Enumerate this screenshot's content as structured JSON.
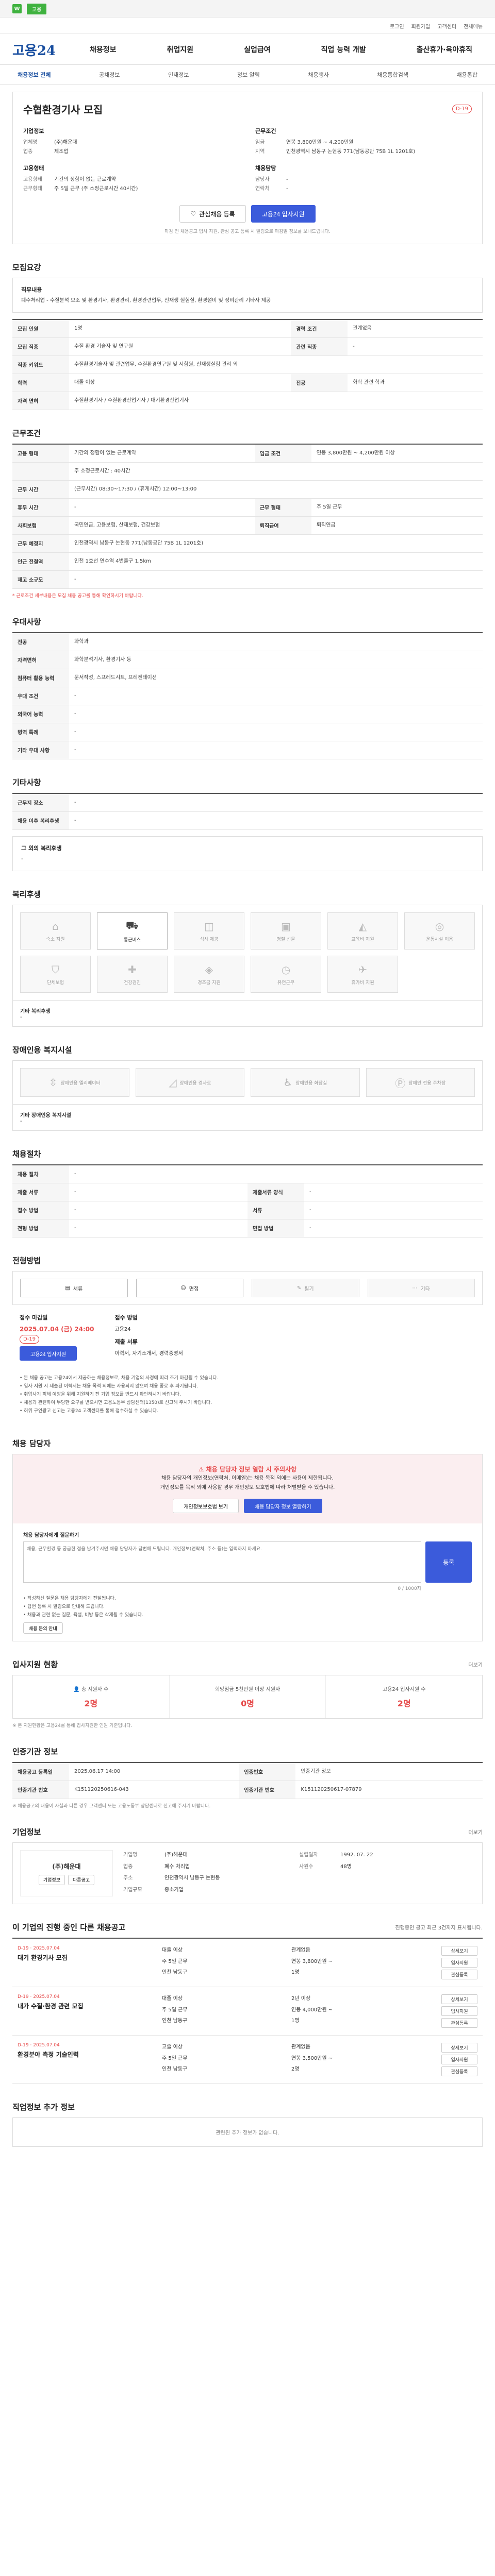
{
  "topbar": {
    "badge": "W",
    "pill": "고용",
    "links": [
      "로그인",
      "회원가입",
      "고객센터",
      "전체메뉴"
    ]
  },
  "header": {
    "logo": "고용24",
    "gnb": [
      "채용정보",
      "취업지원",
      "실업급여",
      "직업 능력 개발",
      "출산휴가·육아휴직"
    ]
  },
  "lnb": [
    "채용정보 전체",
    "공채정보",
    "인재정보",
    "정보 알림",
    "채용행사",
    "채용통합검색",
    "채용통합"
  ],
  "summary": {
    "title": "수협환경기사 모집",
    "dday": "D-19",
    "company_h": "기업정보",
    "company_rows": [
      {
        "k": "업체명",
        "v": "(주)해운대"
      },
      {
        "k": "업종",
        "v": "제조업"
      }
    ],
    "cond_h": "근무조건",
    "cond_rows": [
      {
        "k": "임금",
        "v": "연봉 3,800만원 ~ 4,200만원"
      },
      {
        "k": "지역",
        "v": "인천광역시 남동구 논현동 771(남동공단 75B 1L 1201호)"
      }
    ],
    "qual_h": "고용형태",
    "qual_rows": [
      {
        "k": "고용형태",
        "v": "기간의 정함이 없는 근로계약"
      },
      {
        "k": "근무형태",
        "v": "주 5일 근무 (주 소정근로시간 40시간)"
      }
    ],
    "etc_h": "채용담당",
    "etc_rows": [
      {
        "k": "담당자",
        "v": "-"
      },
      {
        "k": "연락처",
        "v": "-"
      }
    ],
    "btn_scrap": "관심채용 등록",
    "btn_apply": "고용24 입사지원",
    "note": "마감 전 채용공고 입사 지원, 관심 공고 등록 시 알림으로 마감일 정보를 보내드립니다."
  },
  "recruit": {
    "title": "모집요강",
    "duty_label": "직무내용",
    "duty_text": "폐수처리업 - 수질분석 보조 및 환경기사, 환경관리, 환경관련업무, 신재생 실험실, 환경설비 및 정비관리 기타사 제공",
    "rows": [
      {
        "k": "모집 인원",
        "v": "1명",
        "k2": "경력 조건",
        "v2": "관계없음"
      },
      {
        "k": "모집 직종",
        "v": "수질 환경 기술자 및 연구원",
        "k2": "관련 직종",
        "v2": "-"
      },
      {
        "k": "직종 키워드",
        "v": "수질환경기술자 및 관련업무, 수질환경연구원 및 시험원, 신재생실험 관리 외",
        "k2": "",
        "v2": ""
      },
      {
        "k": "학력",
        "v": "대졸 이상",
        "k2": "전공",
        "v2": "화학 관련 학과"
      },
      {
        "k": "자격 면허",
        "v": "수질환경기사 / 수질환경산업기사 / 대기환경산업기사",
        "k2": "",
        "v2": ""
      }
    ]
  },
  "work": {
    "title": "근무조건",
    "rows": [
      {
        "k": "고용 형태",
        "v": "기간의 정함이 없는 근로계약",
        "k2": "임금 조건",
        "v2": "연봉 3,800만원 ~ 4,200만원 이상"
      },
      {
        "k": "",
        "v": "주 소정근로시간 : 40시간",
        "k2": "",
        "v2": ""
      },
      {
        "k": "근무 시간",
        "v": "(근무시간) 08:30~17:30 / (휴게시간) 12:00~13:00",
        "k2": "",
        "v2": ""
      },
      {
        "k": "휴무 시간",
        "v": "-",
        "k2": "근무 형태",
        "v2": "주 5일 근무"
      },
      {
        "k": "사회보험",
        "v": "국민연금, 고용보험, 산재보험, 건강보험",
        "k2": "퇴직급여",
        "v2": "퇴직연금"
      },
      {
        "k": "근무 예정지",
        "v": "인천광역시 남동구 논현동 771(남동공단 75B 1L 1201호)",
        "k2": "",
        "v2": ""
      },
      {
        "k": "인근 전철역",
        "v": "인천 1호선 연수역 4번출구 1.5km",
        "k2": "",
        "v2": ""
      },
      {
        "k": "재고 소규모",
        "v": "-",
        "k2": "",
        "v2": ""
      }
    ],
    "note": "* 근로조건 세부내용은 모집 채용 공고를 통해 확인하시기 바랍니다."
  },
  "prefer": {
    "title": "우대사항",
    "rows": [
      {
        "k": "전공",
        "v": "화학과"
      },
      {
        "k": "자격면허",
        "v": "화학분석기사, 환경기사 등"
      },
      {
        "k": "컴퓨터 활용 능력",
        "v": "문서작성, 스프레드시트, 프레젠테이션"
      },
      {
        "k": "우대 조건",
        "v": "-"
      },
      {
        "k": "외국어 능력",
        "v": "-"
      },
      {
        "k": "병역 특례",
        "v": "-"
      },
      {
        "k": "기타 우대 사항",
        "v": "-"
      }
    ]
  },
  "other": {
    "title": "기타사항",
    "rows": [
      {
        "k": "근무지 장소",
        "v": "-"
      },
      {
        "k": "채용 이후 복리후생",
        "v": "-"
      }
    ],
    "extra_label": "그 외의 복리후생",
    "extra_val": "-"
  },
  "welfare": {
    "title": "복리후생",
    "items": [
      {
        "icon": "house-icon",
        "label": "숙소 지원",
        "on": false
      },
      {
        "icon": "car-icon",
        "label": "통근버스",
        "on": true
      },
      {
        "icon": "meal-icon",
        "label": "식사 제공",
        "on": false
      },
      {
        "icon": "gift-icon",
        "label": "명절 선물",
        "on": false
      },
      {
        "icon": "education-icon",
        "label": "교육비 지원",
        "on": false
      },
      {
        "icon": "sports-icon",
        "label": "운동시설 이용",
        "on": false
      },
      {
        "icon": "shield-icon",
        "label": "단체보험",
        "on": false
      },
      {
        "icon": "medical-icon",
        "label": "건강검진",
        "on": false
      },
      {
        "icon": "money-icon",
        "label": "경조금 지원",
        "on": false
      },
      {
        "icon": "clock-icon",
        "label": "유연근무",
        "on": false
      },
      {
        "icon": "plane-icon",
        "label": "휴가비 지원",
        "on": false
      }
    ],
    "extra_label": "기타 복리후생",
    "extra_val": "-"
  },
  "disabled": {
    "title": "장애인용 복지시설",
    "items": [
      {
        "icon": "elevator-icon",
        "label": "장애인용 엘리베이터",
        "on": false
      },
      {
        "icon": "ramp-icon",
        "label": "장애인용 경사로",
        "on": false
      },
      {
        "icon": "toilet-icon",
        "label": "장애인용 화장실",
        "on": false
      },
      {
        "icon": "parking-icon",
        "label": "장애인 전용 주차장",
        "on": false
      }
    ],
    "extra_label": "기타 장애인용 복지시설",
    "extra_val": "-"
  },
  "attach": {
    "title": "채용절차",
    "rows": [
      {
        "k": "채용 절차",
        "v": "-",
        "k2": "",
        "v2": ""
      },
      {
        "k": "제출 서류",
        "v": "-",
        "k2": "제출서류 양식",
        "v2": "-"
      },
      {
        "k": "접수 방법",
        "v": "-",
        "k2": "서류",
        "v2": "-"
      },
      {
        "k": "전형 방법",
        "v": "-",
        "k2": "면접 방법",
        "v2": "-"
      }
    ]
  },
  "procedure": {
    "title": "전형방법",
    "steps": [
      {
        "icon": "document-icon",
        "label": "서류",
        "on": true
      },
      {
        "icon": "interview-icon",
        "label": "면접",
        "on": true
      },
      {
        "icon": "test-icon",
        "label": "필기",
        "on": false
      },
      {
        "icon": "etc-icon",
        "label": "기타",
        "on": false
      }
    ],
    "deadline_h": "접수 마감일",
    "deadline_v": "2025.07.04 (금) 24:00",
    "deadline_badge": "D-19",
    "deadline_btn": "고용24 입사지원",
    "method_h": "접수 방법",
    "method_v": "고용24",
    "docs_h": "제출 서류",
    "docs_v": "이력서, 자기소개서, 경력증명서",
    "bullets": [
      "본 채용 공고는 고용24에서 제공하는 채용정보로, 채용 기업의 사정에 따라 조기 마감될 수 있습니다.",
      "입사 지원 시 제출된 이력서는 채용 목적 외에는 사용되지 않으며 채용 종료 후 파기됩니다.",
      "취업사기 피해 예방을 위해 지원하기 전 기업 정보를 반드시 확인하시기 바랍니다.",
      "채용과 관련하여 부당한 요구를 받으시면 고용노동부 상담센터(1350)로 신고해 주시기 바랍니다.",
      "허위 구인광고 신고는 고용24 고객센터를 통해 접수하실 수 있습니다."
    ]
  },
  "manager": {
    "title": "채용 담당자",
    "warn": "채용 담당자 정보 열람 시 주의사항",
    "desc1": "채용 담당자의 개인정보(연락처, 이메일)는 채용 목적 외에는 사용이 제한됩니다.",
    "desc2": "개인정보를 목적 외에 사용할 경우 개인정보 보호법에 따라 처벌받을 수 있습니다.",
    "btn1": "개인정보보호법 보기",
    "btn2": "채용 담당자 정보 열람하기",
    "qa_label": "채용 담당자에게 질문하기",
    "qa_placeholder": "채용, 근무환경 등 궁금한 점을 남겨주시면 채용 담당자가 답변해 드립니다. 개인정보(연락처, 주소 등)는 입력하지 마세요.",
    "qa_count": "0 / 1000자",
    "qa_btn": "등록",
    "qa_notes": [
      "작성하신 질문은 채용 담당자에게 전달됩니다.",
      "답변 등록 시 알림으로 안내해 드립니다.",
      "채용과 관련 없는 질문, 욕설, 비방 등은 삭제될 수 있습니다."
    ],
    "qa_link": "채용 문의 안내"
  },
  "applicants": {
    "title": "입사지원 현황",
    "more": "더보기",
    "stats": [
      {
        "label": "총 지원자 수",
        "value": "2명"
      },
      {
        "label": "희망임금 5천만원 이상 지원자",
        "value": "0명"
      },
      {
        "label": "고용24 입사지원 수",
        "value": "2명"
      }
    ],
    "note": "※ 본 지원현황은 고용24를 통해 입사지원한 인원 기준입니다."
  },
  "notice_info": {
    "title": "인증기관 정보",
    "rows": [
      {
        "k": "채용공고 등록일",
        "v": "2025.06.17 14:00",
        "k2": "인증번호",
        "v2": "인증기관 정보"
      },
      {
        "k": "인증기관 번호",
        "v": "K151120250616-043",
        "k2": "인증기관 번호",
        "v2": "K151120250617-07879"
      }
    ],
    "note": "※ 채용공고의 내용이 사실과 다른 경우 고객센터 또는 고용노동부 상담센터로 신고해 주시기 바랍니다."
  },
  "corp": {
    "title": "기업정보",
    "more": "더보기",
    "logo_text": "(주)해운대",
    "logo_btn1": "기업정보",
    "logo_btn2": "다른공고",
    "rows": [
      {
        "k": "기업명",
        "v": "(주)해운대",
        "k2": "설립일자",
        "v2": "1992. 07. 22"
      },
      {
        "k": "업종",
        "v": "폐수 처리업",
        "k2": "사원수",
        "v2": "48명"
      },
      {
        "k": "주소",
        "v": "인천광역시 남동구 논현동",
        "k2": "",
        "v2": ""
      },
      {
        "k": "기업규모",
        "v": "중소기업",
        "k2": "",
        "v2": ""
      }
    ]
  },
  "other_jobs": {
    "title": "이 기업의 진행 중인 다른 채용공고",
    "note": "진행중인 공고 최근 3건까지 표시됩니다.",
    "jobs": [
      {
        "date": "D-19 · 2025.07.04",
        "name": "대기 환경기사 모집",
        "edu": "대졸 이상",
        "career": "관계없음",
        "type": "주 5일 근무",
        "pay": "연봉 3,800만원 ~",
        "loc": "인천 남동구",
        "pos": "1명"
      },
      {
        "date": "D-19 · 2025.07.04",
        "name": "내가 수질·환경 관련 모집",
        "edu": "대졸 이상",
        "career": "2년 이상",
        "type": "주 5일 근무",
        "pay": "연봉 4,000만원 ~",
        "loc": "인천 남동구",
        "pos": "1명"
      },
      {
        "date": "D-19 · 2025.07.04",
        "name": "환경분야 측정 기술인력",
        "edu": "고졸 이상",
        "career": "관계없음",
        "type": "주 5일 근무",
        "pay": "연봉 3,500만원 ~",
        "loc": "인천 남동구",
        "pos": "2명"
      }
    ],
    "btn_detail": "상세보기",
    "btn_apply": "입사지원",
    "btn_scrap": "관심등록"
  },
  "business_info": {
    "title": "직업정보 추가 정보",
    "empty": "관련된 추가 정보가 없습니다."
  }
}
